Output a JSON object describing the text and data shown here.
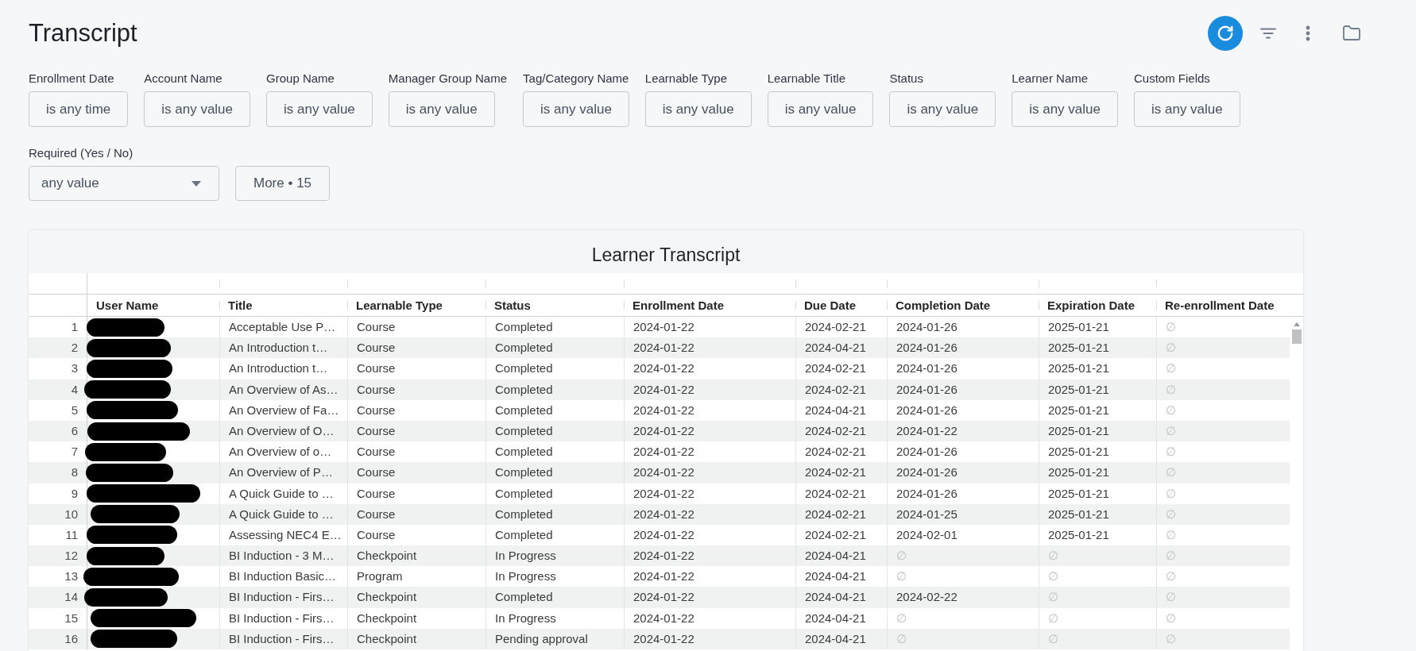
{
  "page": {
    "title": "Transcript"
  },
  "filters": [
    {
      "label": "Enrollment Date",
      "value": "is any time"
    },
    {
      "label": "Account Name",
      "value": "is any value"
    },
    {
      "label": "Group Name",
      "value": "is any value"
    },
    {
      "label": "Manager Group Name",
      "value": "is any value"
    },
    {
      "label": "Tag/Category Name",
      "value": "is any value"
    },
    {
      "label": "Learnable Type",
      "value": "is any value"
    },
    {
      "label": "Learnable Title",
      "value": "is any value"
    },
    {
      "label": "Status",
      "value": "is any value"
    },
    {
      "label": "Learner Name",
      "value": "is any value"
    },
    {
      "label": "Custom Fields",
      "value": "is any value"
    }
  ],
  "required_filter": {
    "label": "Required (Yes / No)",
    "value": "any value"
  },
  "more_button": {
    "label": "More • 15"
  },
  "table": {
    "title": "Learner Transcript",
    "columns": [
      "User Name",
      "Title",
      "Learnable Type",
      "Status",
      "Enrollment Date",
      "Due Date",
      "Completion Date",
      "Expiration Date",
      "Re-enrollment Date"
    ],
    "rows": [
      {
        "number": "1",
        "cells": [
          {
            "kind": "redacted"
          },
          {
            "kind": "value",
            "text": "Acceptable Use P…"
          },
          {
            "kind": "value",
            "text": "Course"
          },
          {
            "kind": "value",
            "text": "Completed"
          },
          {
            "kind": "value",
            "text": "2024-01-22"
          },
          {
            "kind": "value",
            "text": "2024-02-21"
          },
          {
            "kind": "value",
            "text": "2024-01-26"
          },
          {
            "kind": "value",
            "text": "2025-01-21"
          },
          {
            "kind": "null",
            "text": "∅"
          }
        ]
      },
      {
        "number": "2",
        "cells": [
          {
            "kind": "redacted"
          },
          {
            "kind": "value",
            "text": "An Introduction t…"
          },
          {
            "kind": "value",
            "text": "Course"
          },
          {
            "kind": "value",
            "text": "Completed"
          },
          {
            "kind": "value",
            "text": "2024-01-22"
          },
          {
            "kind": "value",
            "text": "2024-04-21"
          },
          {
            "kind": "value",
            "text": "2024-01-26"
          },
          {
            "kind": "value",
            "text": "2025-01-21"
          },
          {
            "kind": "null",
            "text": "∅"
          }
        ]
      },
      {
        "number": "3",
        "cells": [
          {
            "kind": "redacted"
          },
          {
            "kind": "value",
            "text": "An Introduction t…"
          },
          {
            "kind": "value",
            "text": "Course"
          },
          {
            "kind": "value",
            "text": "Completed"
          },
          {
            "kind": "value",
            "text": "2024-01-22"
          },
          {
            "kind": "value",
            "text": "2024-02-21"
          },
          {
            "kind": "value",
            "text": "2024-01-26"
          },
          {
            "kind": "value",
            "text": "2025-01-21"
          },
          {
            "kind": "null",
            "text": "∅"
          }
        ]
      },
      {
        "number": "4",
        "cells": [
          {
            "kind": "redacted"
          },
          {
            "kind": "value",
            "text": "An Overview of As…"
          },
          {
            "kind": "value",
            "text": "Course"
          },
          {
            "kind": "value",
            "text": "Completed"
          },
          {
            "kind": "value",
            "text": "2024-01-22"
          },
          {
            "kind": "value",
            "text": "2024-02-21"
          },
          {
            "kind": "value",
            "text": "2024-01-26"
          },
          {
            "kind": "value",
            "text": "2025-01-21"
          },
          {
            "kind": "null",
            "text": "∅"
          }
        ]
      },
      {
        "number": "5",
        "cells": [
          {
            "kind": "redacted"
          },
          {
            "kind": "value",
            "text": "An Overview of Fa…"
          },
          {
            "kind": "value",
            "text": "Course"
          },
          {
            "kind": "value",
            "text": "Completed"
          },
          {
            "kind": "value",
            "text": "2024-01-22"
          },
          {
            "kind": "value",
            "text": "2024-04-21"
          },
          {
            "kind": "value",
            "text": "2024-01-26"
          },
          {
            "kind": "value",
            "text": "2025-01-21"
          },
          {
            "kind": "null",
            "text": "∅"
          }
        ]
      },
      {
        "number": "6",
        "cells": [
          {
            "kind": "redacted"
          },
          {
            "kind": "value",
            "text": "An Overview of O…"
          },
          {
            "kind": "value",
            "text": "Course"
          },
          {
            "kind": "value",
            "text": "Completed"
          },
          {
            "kind": "value",
            "text": "2024-01-22"
          },
          {
            "kind": "value",
            "text": "2024-02-21"
          },
          {
            "kind": "value",
            "text": "2024-01-22"
          },
          {
            "kind": "value",
            "text": "2025-01-21"
          },
          {
            "kind": "null",
            "text": "∅"
          }
        ]
      },
      {
        "number": "7",
        "cells": [
          {
            "kind": "redacted"
          },
          {
            "kind": "value",
            "text": "An Overview of o…"
          },
          {
            "kind": "value",
            "text": "Course"
          },
          {
            "kind": "value",
            "text": "Completed"
          },
          {
            "kind": "value",
            "text": "2024-01-22"
          },
          {
            "kind": "value",
            "text": "2024-02-21"
          },
          {
            "kind": "value",
            "text": "2024-01-26"
          },
          {
            "kind": "value",
            "text": "2025-01-21"
          },
          {
            "kind": "null",
            "text": "∅"
          }
        ]
      },
      {
        "number": "8",
        "cells": [
          {
            "kind": "redacted"
          },
          {
            "kind": "value",
            "text": "An Overview of P…"
          },
          {
            "kind": "value",
            "text": "Course"
          },
          {
            "kind": "value",
            "text": "Completed"
          },
          {
            "kind": "value",
            "text": "2024-01-22"
          },
          {
            "kind": "value",
            "text": "2024-02-21"
          },
          {
            "kind": "value",
            "text": "2024-01-26"
          },
          {
            "kind": "value",
            "text": "2025-01-21"
          },
          {
            "kind": "null",
            "text": "∅"
          }
        ]
      },
      {
        "number": "9",
        "cells": [
          {
            "kind": "redacted"
          },
          {
            "kind": "value",
            "text": "A Quick Guide to …"
          },
          {
            "kind": "value",
            "text": "Course"
          },
          {
            "kind": "value",
            "text": "Completed"
          },
          {
            "kind": "value",
            "text": "2024-01-22"
          },
          {
            "kind": "value",
            "text": "2024-02-21"
          },
          {
            "kind": "value",
            "text": "2024-01-26"
          },
          {
            "kind": "value",
            "text": "2025-01-21"
          },
          {
            "kind": "null",
            "text": "∅"
          }
        ]
      },
      {
        "number": "10",
        "cells": [
          {
            "kind": "redacted"
          },
          {
            "kind": "value",
            "text": "A Quick Guide to …"
          },
          {
            "kind": "value",
            "text": "Course"
          },
          {
            "kind": "value",
            "text": "Completed"
          },
          {
            "kind": "value",
            "text": "2024-01-22"
          },
          {
            "kind": "value",
            "text": "2024-02-21"
          },
          {
            "kind": "value",
            "text": "2024-01-25"
          },
          {
            "kind": "value",
            "text": "2025-01-21"
          },
          {
            "kind": "null",
            "text": "∅"
          }
        ]
      },
      {
        "number": "11",
        "cells": [
          {
            "kind": "redacted"
          },
          {
            "kind": "value",
            "text": "Assessing NEC4 E…"
          },
          {
            "kind": "value",
            "text": "Course"
          },
          {
            "kind": "value",
            "text": "Completed"
          },
          {
            "kind": "value",
            "text": "2024-01-22"
          },
          {
            "kind": "value",
            "text": "2024-02-21"
          },
          {
            "kind": "value",
            "text": "2024-02-01"
          },
          {
            "kind": "value",
            "text": "2025-01-21"
          },
          {
            "kind": "null",
            "text": "∅"
          }
        ]
      },
      {
        "number": "12",
        "cells": [
          {
            "kind": "redacted"
          },
          {
            "kind": "value",
            "text": "BI Induction - 3 M…"
          },
          {
            "kind": "value",
            "text": "Checkpoint"
          },
          {
            "kind": "value",
            "text": "In Progress"
          },
          {
            "kind": "value",
            "text": "2024-01-22"
          },
          {
            "kind": "value",
            "text": "2024-04-21"
          },
          {
            "kind": "null",
            "text": "∅"
          },
          {
            "kind": "null",
            "text": "∅"
          },
          {
            "kind": "null",
            "text": "∅"
          }
        ]
      },
      {
        "number": "13",
        "cells": [
          {
            "kind": "redacted"
          },
          {
            "kind": "value",
            "text": "BI Induction Basic…"
          },
          {
            "kind": "value",
            "text": "Program"
          },
          {
            "kind": "value",
            "text": "In Progress"
          },
          {
            "kind": "value",
            "text": "2024-01-22"
          },
          {
            "kind": "value",
            "text": "2024-04-21"
          },
          {
            "kind": "null",
            "text": "∅"
          },
          {
            "kind": "null",
            "text": "∅"
          },
          {
            "kind": "null",
            "text": "∅"
          }
        ]
      },
      {
        "number": "14",
        "cells": [
          {
            "kind": "redacted"
          },
          {
            "kind": "value",
            "text": "BI Induction - Firs…"
          },
          {
            "kind": "value",
            "text": "Checkpoint"
          },
          {
            "kind": "value",
            "text": "Completed"
          },
          {
            "kind": "value",
            "text": "2024-01-22"
          },
          {
            "kind": "value",
            "text": "2024-04-21"
          },
          {
            "kind": "value",
            "text": "2024-02-22"
          },
          {
            "kind": "null",
            "text": "∅"
          },
          {
            "kind": "null",
            "text": "∅"
          }
        ]
      },
      {
        "number": "15",
        "cells": [
          {
            "kind": "redacted"
          },
          {
            "kind": "value",
            "text": "BI Induction - Firs…"
          },
          {
            "kind": "value",
            "text": "Checkpoint"
          },
          {
            "kind": "value",
            "text": "In Progress"
          },
          {
            "kind": "value",
            "text": "2024-01-22"
          },
          {
            "kind": "value",
            "text": "2024-04-21"
          },
          {
            "kind": "null",
            "text": "∅"
          },
          {
            "kind": "null",
            "text": "∅"
          },
          {
            "kind": "null",
            "text": "∅"
          }
        ]
      },
      {
        "number": "16",
        "cells": [
          {
            "kind": "redacted"
          },
          {
            "kind": "value",
            "text": "BI Induction - Firs…"
          },
          {
            "kind": "value",
            "text": "Checkpoint"
          },
          {
            "kind": "value",
            "text": "Pending approval"
          },
          {
            "kind": "value",
            "text": "2024-01-22"
          },
          {
            "kind": "value",
            "text": "2024-04-21"
          },
          {
            "kind": "null",
            "text": "∅"
          },
          {
            "kind": "null",
            "text": "∅"
          },
          {
            "kind": "null",
            "text": "∅"
          }
        ]
      }
    ]
  }
}
